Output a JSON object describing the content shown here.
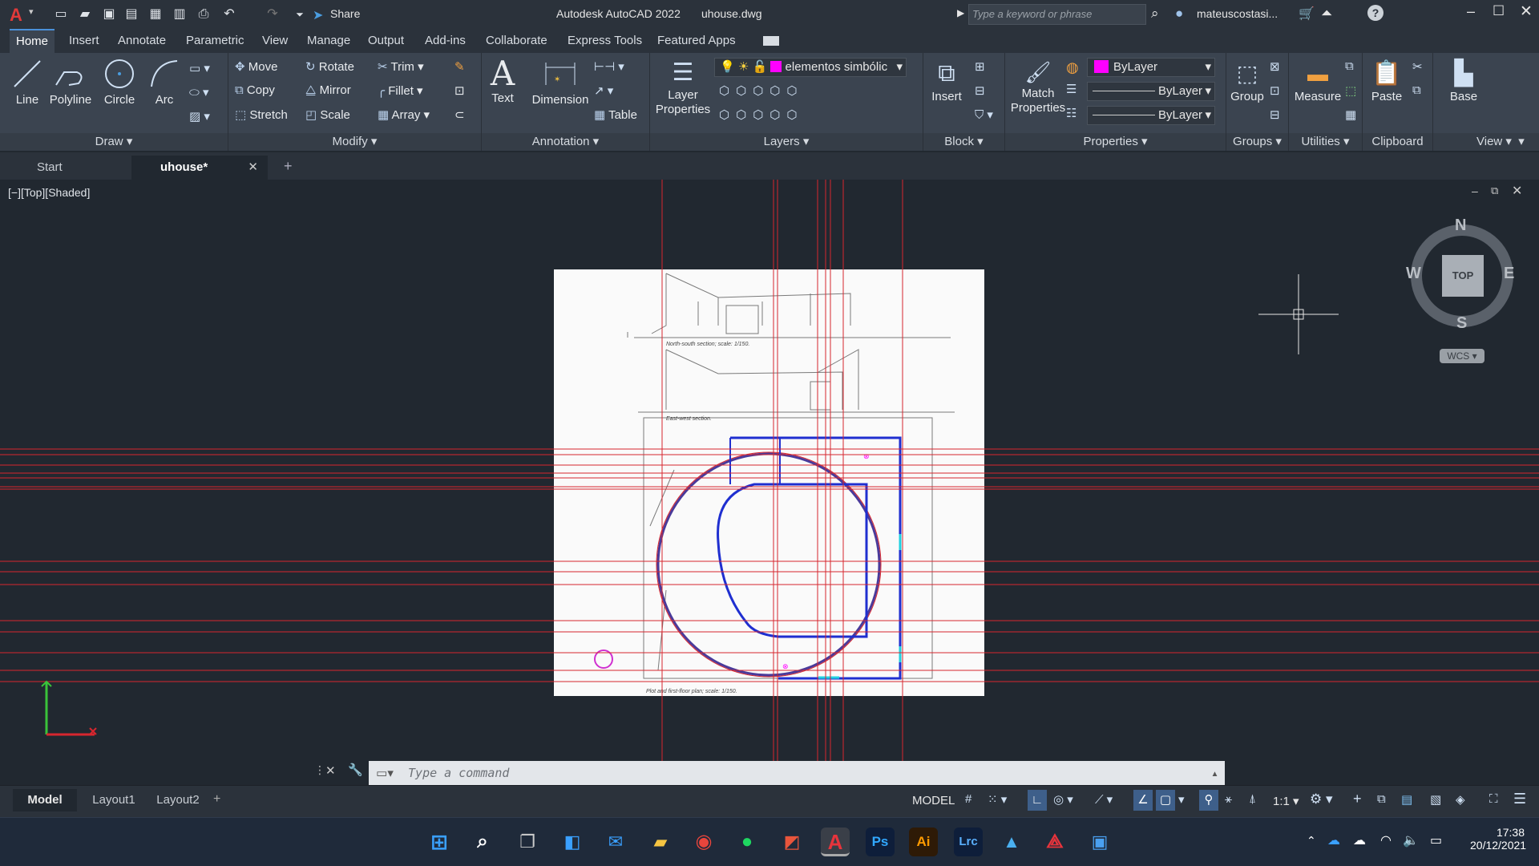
{
  "titlebar": {
    "app_title": "Autodesk AutoCAD 2022",
    "filename": "uhouse.dwg",
    "share_label": "Share",
    "search_placeholder": "Type a keyword or phrase",
    "user": "mateuscostasi..."
  },
  "ribbon_tabs": [
    "Home",
    "Insert",
    "Annotate",
    "Parametric",
    "View",
    "Manage",
    "Output",
    "Add-ins",
    "Collaborate",
    "Express Tools",
    "Featured Apps"
  ],
  "draw": {
    "title": "Draw",
    "line": "Line",
    "polyline": "Polyline",
    "circle": "Circle",
    "arc": "Arc"
  },
  "modify": {
    "title": "Modify",
    "move": "Move",
    "rotate": "Rotate",
    "trim": "Trim",
    "copy": "Copy",
    "mirror": "Mirror",
    "fillet": "Fillet",
    "stretch": "Stretch",
    "scale": "Scale",
    "array": "Array"
  },
  "annotation": {
    "title": "Annotation",
    "text": "Text",
    "dimension": "Dimension",
    "table": "Table"
  },
  "layers": {
    "title": "Layers",
    "properties_line1": "Layer",
    "properties_line2": "Properties",
    "current_layer": "elementos simbólic"
  },
  "block": {
    "title": "Block",
    "insert": "Insert"
  },
  "properties": {
    "title": "Properties",
    "match_line1": "Match",
    "match_line2": "Properties",
    "color": "ByLayer",
    "linetype": "ByLayer",
    "lineweight": "ByLayer"
  },
  "groups": {
    "title": "Groups",
    "group": "Group"
  },
  "utilities": {
    "title": "Utilities",
    "measure": "Measure"
  },
  "clipboard": {
    "title": "Clipboard",
    "paste": "Paste"
  },
  "view_panel": {
    "title": "View",
    "base": "Base"
  },
  "doc_tabs": {
    "start": "Start",
    "current": "uhouse*"
  },
  "viewport": {
    "label": "[−][Top][Shaded]",
    "compass": {
      "n": "N",
      "s": "S",
      "e": "E",
      "w": "W",
      "top": "TOP",
      "wcs": "WCS"
    },
    "sheet_labels": {
      "section1": "North-south section; scale: 1/150.",
      "section2": "East-west section.",
      "plan": "Plot and first-floor plan; scale: 1/150."
    }
  },
  "command": {
    "placeholder": "Type a command"
  },
  "layout_tabs": [
    "Model",
    "Layout1",
    "Layout2"
  ],
  "status": {
    "model": "MODEL",
    "scale": "1:1"
  },
  "taskbar": {
    "apps": [
      "Ps",
      "Ai",
      "Lrc"
    ],
    "time": "17:38",
    "date": "20/12/2021"
  },
  "colors": {
    "accent": "#4a90d9",
    "magenta": "#ff00ff",
    "red_lines": "#d7262e",
    "blue_plan": "#1f2fd0"
  }
}
